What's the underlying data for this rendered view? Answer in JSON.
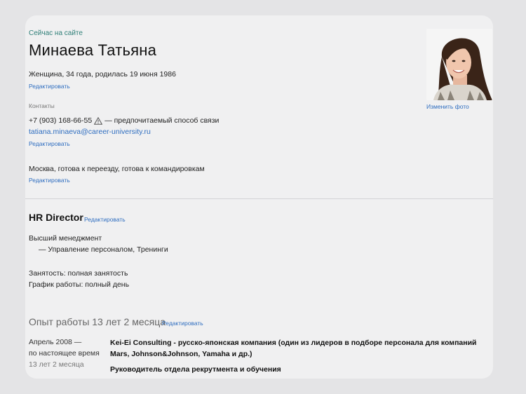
{
  "profile": {
    "status": "Сейчас на сайте",
    "name": "Минаева Татьяна",
    "personal_info": "Женщина, 34 года, родилась 19 июня 1986",
    "edit_label": "Редактировать",
    "photo_change_label": "Изменить фото"
  },
  "contacts": {
    "heading": "Контакты",
    "phone": "+7 (903) 168-66-55",
    "phone_icon": "warning-triangle-icon",
    "phone_note": "— предпочитаемый способ связи",
    "email": "tatiana.minaeva@career-university.ru",
    "edit_label": "Редактировать"
  },
  "location": {
    "text": "Москва, готова к переезду, готова к командировкам",
    "edit_label": "Редактировать"
  },
  "position": {
    "title": "HR Director",
    "edit_label": "Редактировать",
    "specialization": "Высший менеджмент",
    "subspecialization": "— Управление персоналом, Тренинги",
    "employment": "Занятость: полная занятость",
    "schedule": "График работы: полный день"
  },
  "experience": {
    "heading": "Опыт работы 13 лет 2 месяца",
    "edit_label": "Редактировать",
    "items": [
      {
        "date_from": "Апрель 2008 —",
        "date_to": "по настоящее время",
        "duration": "13 лет 2 месяца",
        "company": "Kei-Ei Consulting - русско-японская компания (один из лидеров в подборе персонала для компаний Mars, Johnson&Johnson, Yamaha и др.)",
        "role": "Руководитель отдела рекрутмента и обучения"
      }
    ]
  },
  "colors": {
    "link": "#2f6ec0",
    "online": "#2f7f78",
    "background": "#e4e4e6",
    "card": "#f0f0f1"
  }
}
